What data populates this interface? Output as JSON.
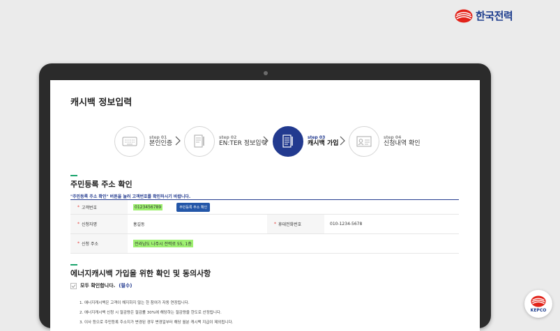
{
  "brand": {
    "name": "한국전력",
    "badge_text": "KEPCO",
    "colors": {
      "navy": "#223a8f",
      "red": "#e2231a",
      "green_highlight": "#9ef071",
      "accent_green": "#17a36b"
    }
  },
  "page": {
    "title": "캐시백 정보입력"
  },
  "steps": [
    {
      "num": "step 01",
      "label": "본인인증",
      "icon": "keyboard-icon",
      "active": false
    },
    {
      "num": "step 02",
      "label": "EN:TER 정보입력",
      "icon": "document-pen-icon",
      "active": false
    },
    {
      "num": "step 03",
      "label": "캐시백 가입",
      "icon": "form-pen-icon",
      "active": true
    },
    {
      "num": "step 04",
      "label": "신청내역 확인",
      "icon": "id-card-icon",
      "active": false
    }
  ],
  "address_section": {
    "title": "주민등록 주소 확인",
    "notice": "\"주민등록 주소 확인\" 버튼을 눌러 고객번호를 확인하시기 바랍니다.",
    "rows": {
      "customer_no": {
        "label": "고객번호",
        "value": "0123456789",
        "button": "주민등록 주소 확인"
      },
      "applicant": {
        "label": "신청자명",
        "value": "홍길동",
        "phone_label": "휴대전화번호",
        "phone_value": "010-1234-5678"
      },
      "address": {
        "label": "신청 주소",
        "value": "전라남도 나주시 전력로 55, 1층"
      }
    },
    "required_mark": "*"
  },
  "consent_section": {
    "title": "에너지캐시백 가입을 위한 확인 및 동의사항",
    "agree_all": "모두 확인합니다.",
    "agree_required": "(필수)",
    "terms": [
      "1. 에너지캐시백은 고객이 해지하지 않는 한 참여가 자동 연장됩니다.",
      "2. 에너지캐시백 신청 시 절감량은 절감률 30%에 해당하는 절감량을 한도로 산정됩니다.",
      "3. 이사 등으로 주민등록 주소지가 변경된 경우 변경일부터 해당 월분 캐시백 지급이 제외됩니다."
    ]
  }
}
